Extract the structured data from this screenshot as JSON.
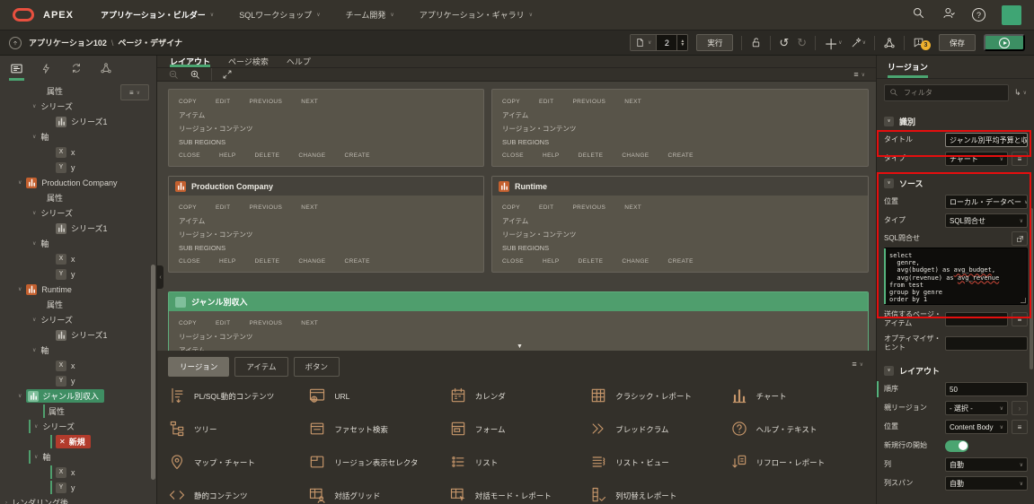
{
  "topbar": {
    "brand": "APEX",
    "active_menu": 0,
    "menus": [
      "アプリケーション・ビルダー",
      "SQLワークショップ",
      "チーム開発",
      "アプリケーション・ギャラリ"
    ]
  },
  "breadcrumb": {
    "app": "アプリケーション102",
    "sep": "\\",
    "page": "ページ・デザイナ"
  },
  "toolbar": {
    "page_number": "2",
    "run_label": "実行",
    "save_label": "保存",
    "badge_count": "3"
  },
  "tree": {
    "items": [
      {
        "label": "属性",
        "ind": 52
      },
      {
        "label": "シリーズ",
        "ind": 36,
        "caret": "open"
      },
      {
        "label": "シリーズ1",
        "ind": 62,
        "icon": "chart-gray"
      },
      {
        "label": "軸",
        "ind": 36,
        "caret": "open"
      },
      {
        "label": "x",
        "ind": 62,
        "icon": "x"
      },
      {
        "label": "y",
        "ind": 62,
        "icon": "y"
      },
      {
        "label": "Production Company",
        "ind": 20,
        "caret": "open",
        "icon": "chart-orange"
      },
      {
        "label": "属性",
        "ind": 52
      },
      {
        "label": "シリーズ",
        "ind": 36,
        "caret": "open"
      },
      {
        "label": "シリーズ1",
        "ind": 62,
        "icon": "chart-gray"
      },
      {
        "label": "軸",
        "ind": 36,
        "caret": "open"
      },
      {
        "label": "x",
        "ind": 62,
        "icon": "x"
      },
      {
        "label": "y",
        "ind": 62,
        "icon": "y"
      },
      {
        "label": "Runtime",
        "ind": 20,
        "caret": "open",
        "icon": "chart-orange"
      },
      {
        "label": "属性",
        "ind": 52
      },
      {
        "label": "シリーズ",
        "ind": 36,
        "caret": "open"
      },
      {
        "label": "シリーズ1",
        "ind": 62,
        "icon": "chart-gray"
      },
      {
        "label": "軸",
        "ind": 36,
        "caret": "open"
      },
      {
        "label": "x",
        "ind": 62,
        "icon": "x"
      },
      {
        "label": "y",
        "ind": 62,
        "icon": "y"
      },
      {
        "label": "ジャンル別収入",
        "ind": 20,
        "caret": "open",
        "icon": "chart-green",
        "state": "selected"
      },
      {
        "label": "属性",
        "ind": 48,
        "path": true
      },
      {
        "label": "シリーズ",
        "ind": 32,
        "caret": "open",
        "path": true
      },
      {
        "label": "新規",
        "ind": 56,
        "icon": "new",
        "state": "error",
        "path": true
      },
      {
        "label": "軸",
        "ind": 32,
        "caret": "open",
        "path": true
      },
      {
        "label": "x",
        "ind": 56,
        "icon": "x",
        "path": true
      },
      {
        "label": "y",
        "ind": 56,
        "icon": "y",
        "path": true
      },
      {
        "label": "レンダリング後",
        "ind": 6,
        "caret": "closed"
      }
    ]
  },
  "layout": {
    "tabs": [
      "レイアウト",
      "ページ検索",
      "ヘルプ"
    ],
    "active_tab": 0,
    "actions_top": [
      "COPY",
      "EDIT",
      "PREVIOUS",
      "NEXT"
    ],
    "actions_bottom": [
      "CLOSE",
      "HELP",
      "DELETE",
      "CHANGE",
      "CREATE"
    ],
    "slots_default": [
      "アイテム",
      "リージョン・コンテンツ",
      "SUB REGIONS"
    ],
    "slots_selected": [
      "リージョン・コンテンツ",
      "アイテム",
      "SUB REGIONS"
    ],
    "regions": [
      {
        "title": ""
      },
      {
        "title": ""
      },
      {
        "title": "Production Company",
        "icon": "chart-orange"
      },
      {
        "title": "Runtime",
        "icon": "chart-orange"
      },
      {
        "title": "ジャンル別収入",
        "icon": "chart-green-light",
        "selected": true
      }
    ]
  },
  "gallery": {
    "tabs": [
      "リージョン",
      "アイテム",
      "ボタン"
    ],
    "active_tab": 0,
    "items": [
      {
        "icon": "plsql",
        "label": "PL/SQL動的コンテンツ"
      },
      {
        "icon": "url",
        "label": "URL"
      },
      {
        "icon": "calendar",
        "label": "カレンダ"
      },
      {
        "icon": "report",
        "label": "クラシック・レポート"
      },
      {
        "icon": "chart",
        "label": "チャート"
      },
      {
        "icon": "tree",
        "label": "ツリー"
      },
      {
        "icon": "facet",
        "label": "ファセット検索"
      },
      {
        "icon": "form",
        "label": "フォーム"
      },
      {
        "icon": "breadcrumb",
        "label": "ブレッドクラム"
      },
      {
        "icon": "help",
        "label": "ヘルプ・テキスト"
      },
      {
        "icon": "map",
        "label": "マップ・チャート"
      },
      {
        "icon": "selector",
        "label": "リージョン表示セレクタ"
      },
      {
        "icon": "list",
        "label": "リスト"
      },
      {
        "icon": "listview",
        "label": "リスト・ビュー"
      },
      {
        "icon": "reflow",
        "label": "リフロー・レポート"
      },
      {
        "icon": "code",
        "label": "静的コンテンツ"
      },
      {
        "icon": "gridperson",
        "label": "対話グリッド"
      },
      {
        "icon": "gridcursor",
        "label": "対話モード・レポート"
      },
      {
        "icon": "coltoggle",
        "label": "列切替えレポート"
      }
    ]
  },
  "props": {
    "tab": "リージョン",
    "filter_placeholder": "フィルタ",
    "identification": {
      "title": "識別",
      "title_label": "タイトル",
      "title_value": "ジャンル別平均予算と収入",
      "type_label": "タイプ",
      "type_value": "チャート"
    },
    "source": {
      "title": "ソース",
      "location_label": "位置",
      "location_value": "ローカル・データベー",
      "type_label": "タイプ",
      "type_value": "SQL問合せ",
      "sql_label": "SQL問合せ",
      "sql_code": "select\n  genre,\n  avg(budget) as avg_budget,\n  avg(revenue) as avg_revenue\nfrom test\ngroup by genre\norder by 1",
      "underlined_words": [
        "avg_budget",
        "avg_revenue"
      ]
    },
    "page_items_label": "送信するページ・アイテム",
    "optimizer_label": "オプティマイザ・ヒント",
    "layout_section": {
      "title": "レイアウト",
      "order_label": "順序",
      "order_value": "50",
      "parent_label": "親リージョン",
      "parent_value": "- 選択 -",
      "position_label": "位置",
      "position_value": "Content Body",
      "newrow_label": "新規行の開始",
      "newrow_on": true,
      "column_label": "列",
      "column_value": "自動",
      "colspan_label": "列スパン",
      "colspan_value": "自動"
    }
  }
}
